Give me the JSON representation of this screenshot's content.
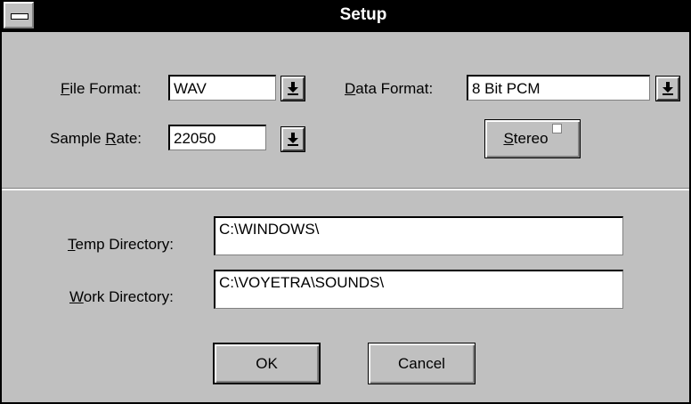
{
  "window": {
    "title": "Setup"
  },
  "file_format": {
    "label_prefix": "",
    "label_mnemonic": "F",
    "label_rest": "ile Format:",
    "value": "WAV"
  },
  "sample_rate": {
    "label_prefix": "Sample ",
    "label_mnemonic": "R",
    "label_rest": "ate:",
    "value": "22050"
  },
  "data_format": {
    "label_prefix": "",
    "label_mnemonic": "D",
    "label_rest": "ata Format:",
    "value": "8 Bit PCM"
  },
  "stereo": {
    "label_mnemonic": "S",
    "label_rest": "tereo",
    "checked": false
  },
  "temp_directory": {
    "label_mnemonic": "T",
    "label_rest": "emp Directory:",
    "value": "C:\\WINDOWS\\"
  },
  "work_directory": {
    "label_mnemonic": "W",
    "label_rest": "ork Directory:",
    "value": "C:\\VOYETRA\\SOUNDS\\"
  },
  "buttons": {
    "ok": "OK",
    "cancel": "Cancel"
  },
  "icons": {
    "dropdown": "dropdown-arrow-icon",
    "system_menu": "system-menu-icon"
  }
}
